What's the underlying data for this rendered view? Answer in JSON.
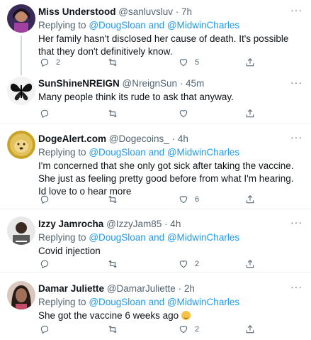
{
  "tweets": [
    {
      "name": "Miss Understood",
      "handle": "@sanluvsluv",
      "time": "· 7h",
      "reply_prefix": "Replying to",
      "reply_mentions": "@DougSloan and @MidwinCharles",
      "text": "Her family hasn't disclosed her cause of death. It's possible that they don't definitively know.",
      "replies": "2",
      "retweets": "",
      "likes": "5",
      "more": "···"
    },
    {
      "name": "SunShineNREIGN",
      "handle": "@NreignSun",
      "time": "· 45m",
      "text": "Many people think its rude to ask that anyway.",
      "replies": "",
      "retweets": "",
      "likes": "",
      "more": "···"
    },
    {
      "name": "DogeAlert.com",
      "handle": "@Dogecoins_",
      "time": "· 4h",
      "reply_prefix": "Replying to",
      "reply_mentions": "@DougSloan and @MidwinCharles",
      "text": "I'm concerned that she only got sick after taking the vaccine. She just as feeling pretty good before from what I'm hearing.  Id love to o hear more",
      "replies": "",
      "retweets": "",
      "likes": "6",
      "more": "···"
    },
    {
      "name": "Izzy Jamrocha",
      "handle": "@IzzyJam85",
      "time": "· 4h",
      "reply_prefix": "Replying to",
      "reply_mentions": "@DougSloan and @MidwinCharles",
      "text": "Covid injection",
      "replies": "",
      "retweets": "",
      "likes": "2",
      "more": "···"
    },
    {
      "name": "Damar Juliette",
      "handle": "@DamarJuliette",
      "time": "· 2h",
      "reply_prefix": "Replying to",
      "reply_mentions": "@DougSloan and @MidwinCharles",
      "text": "She got the vaccine 6 weeks ago",
      "replies": "",
      "retweets": "",
      "likes": "2",
      "more": "···"
    }
  ],
  "icons": [
    "reply-icon",
    "retweet-icon",
    "like-icon",
    "share-icon",
    "more-icon",
    "relieved-emoji"
  ],
  "colors": {
    "link": "#1d9bf0",
    "muted": "#536471",
    "text": "#0f1419",
    "thread_line": "#cfd9de"
  }
}
